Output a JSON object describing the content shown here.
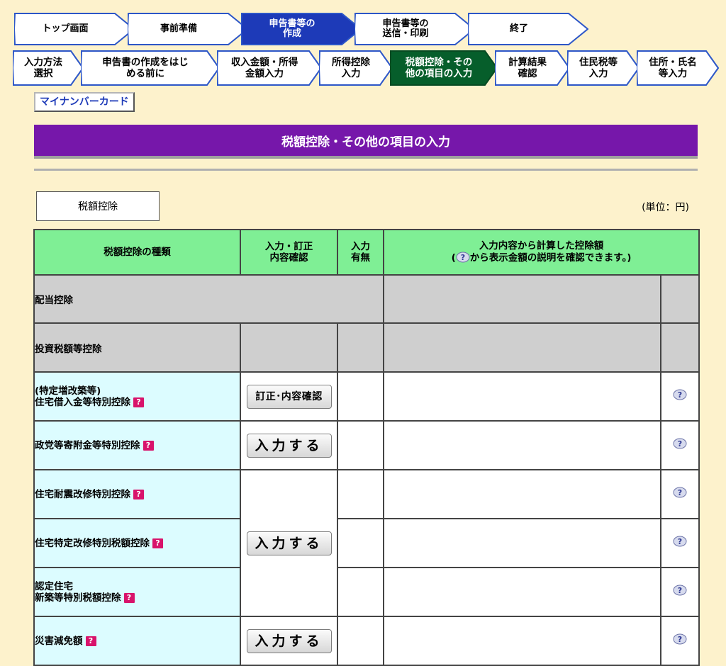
{
  "steps_main": [
    {
      "label": "トップ画面",
      "current": false
    },
    {
      "label": "事前準備",
      "current": false
    },
    {
      "label": "申告書等の\n作成",
      "current": true
    },
    {
      "label": "申告書等の\n送信・印刷",
      "current": false
    },
    {
      "label": "終了",
      "current": false
    }
  ],
  "steps_sub": [
    {
      "label": "入力方法\n選択",
      "current": false
    },
    {
      "label": "申告書の作成をはじ\nめる前に",
      "current": false
    },
    {
      "label": "収入金額・所得\n金額入力",
      "current": false
    },
    {
      "label": "所得控除\n入力",
      "current": false
    },
    {
      "label": "税額控除・その\n他の項目の入力",
      "current": true
    },
    {
      "label": "計算結果\n確認",
      "current": false
    },
    {
      "label": "住民税等\n入力",
      "current": false
    },
    {
      "label": "住所・氏名\n等入力",
      "current": false
    }
  ],
  "mynumber_label": "マイナンバーカード",
  "page_title": "税額控除・その他の項目の入力",
  "section_label": "税額控除",
  "unit_label": "(単位：円)",
  "table": {
    "header_type": "税額控除の種類",
    "header_input": "入力・訂正\n内容確認",
    "header_has": "入力\n有無",
    "header_amount_1": "入力内容から計算した控除額",
    "header_amount_2a": "(",
    "header_amount_2b": "から表示金額の説明を確認できます。)",
    "group_dividend": "配当控除",
    "group_investment": "投資税額等控除",
    "row_housing_loan": "(特定増改築等)\n住宅借入金等特別控除",
    "row_political": "政党等寄附金等特別控除",
    "row_seismic": "住宅耐震改修特別控除",
    "row_renovation": "住宅特定改修特別税額控除",
    "row_certified": "認定住宅\n新築等特別税額控除",
    "row_disaster": "災害減免額",
    "btn_correct": "訂正･内容確認",
    "btn_input": "入力する",
    "help_glyph": "?"
  },
  "colors": {
    "current_step": "#065e2b",
    "title_bar": "#7617aa",
    "header_bg": "#7fef95",
    "row_bg": "#dcfcff",
    "page_bg": "#fdf2cc"
  }
}
